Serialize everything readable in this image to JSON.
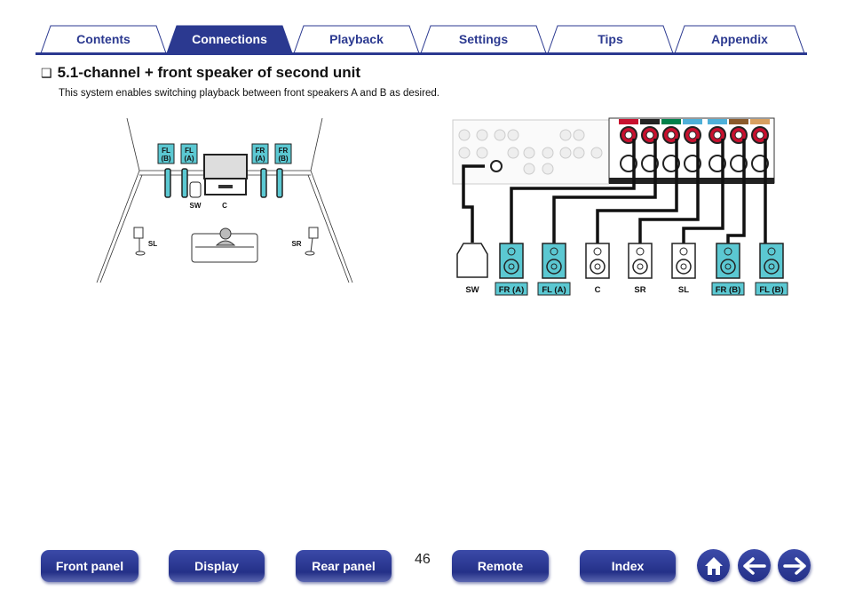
{
  "tabs": [
    {
      "label": "Contents"
    },
    {
      "label": "Connections",
      "active": true
    },
    {
      "label": "Playback"
    },
    {
      "label": "Settings"
    },
    {
      "label": "Tips"
    },
    {
      "label": "Appendix"
    }
  ],
  "section": {
    "bullet": "❑",
    "title": "5.1-channel + front speaker of second unit",
    "description": "This system enables switching playback between front speakers A and B as desired."
  },
  "room": {
    "labels": {
      "fl_b": [
        "FL",
        "(B)"
      ],
      "fl_a": [
        "FL",
        "(A)"
      ],
      "fr_a": [
        "FR",
        "(A)"
      ],
      "fr_b": [
        "FR",
        "(B)"
      ],
      "sw": "SW",
      "c": "C",
      "sl": "SL",
      "sr": "SR"
    }
  },
  "wiring": {
    "speakers": [
      "SW",
      "FR (A)",
      "FL (A)",
      "C",
      "SR",
      "SL",
      "FR (B)",
      "FL (B)"
    ]
  },
  "colors": {
    "accent": "#2b3990",
    "speaker_teal": "#5bc8d2"
  },
  "footer": {
    "page": "46",
    "buttons": [
      "Front panel",
      "Display",
      "Rear panel",
      "Remote",
      "Index"
    ],
    "icons": [
      "home-icon",
      "arrow-left-icon",
      "arrow-right-icon"
    ]
  }
}
